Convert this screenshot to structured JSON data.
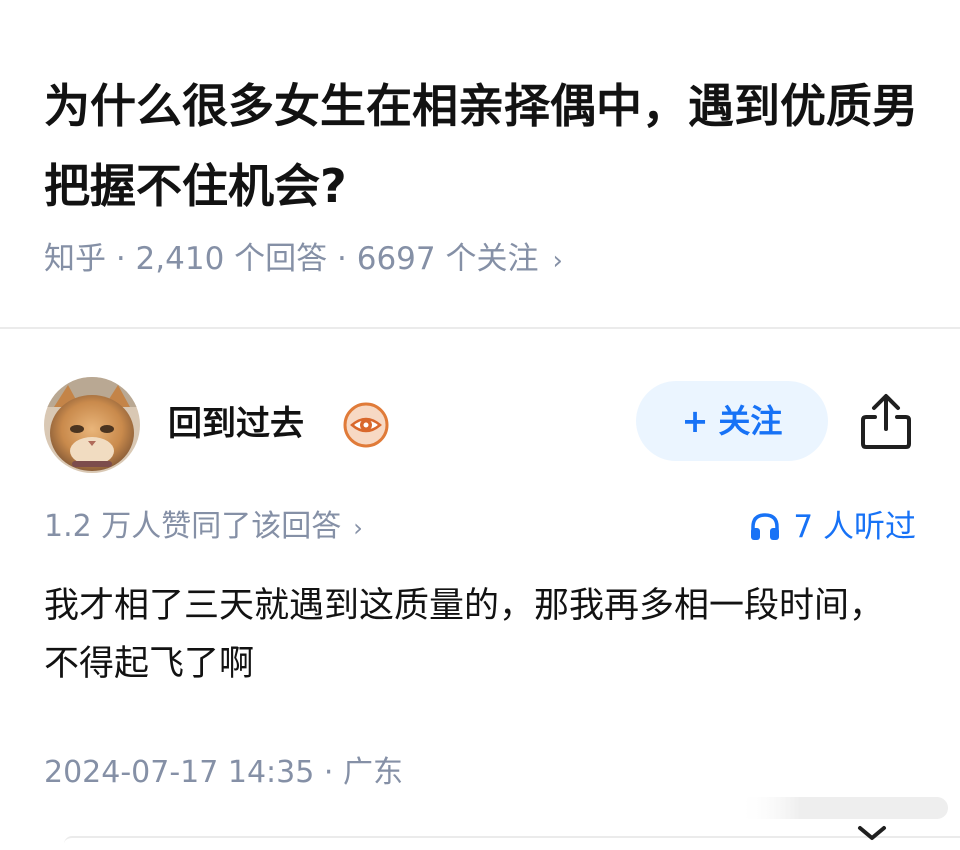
{
  "question": {
    "title": "为什么很多女生在相亲择偶中，遇到优质男把握不住机会?",
    "meta": "知乎 · 2,410 个回答 · 6697 个关注",
    "meta_chevron": "›"
  },
  "answer": {
    "author": {
      "name": "回到过去",
      "avatar_icon": "cat-avatar",
      "badge_icon": "eye-badge-icon"
    },
    "follow_button": {
      "plus": "+",
      "label": "关注"
    },
    "share_icon": "share-icon",
    "votes": "1.2 万人赞同了该回答",
    "votes_chevron": "›",
    "listen": "7 人听过",
    "listen_icon": "headphones-icon",
    "content": "我才相了三天就遇到这质量的，那我再多相一段时间，不得起飞了啊",
    "meta": "2024-07-17 14:35 · 广东"
  },
  "colors": {
    "text_primary": "#121212",
    "text_secondary": "#8590a6",
    "brand_blue": "#1772f6",
    "follow_bg": "#ebf5ff",
    "divider": "#ebebeb"
  }
}
